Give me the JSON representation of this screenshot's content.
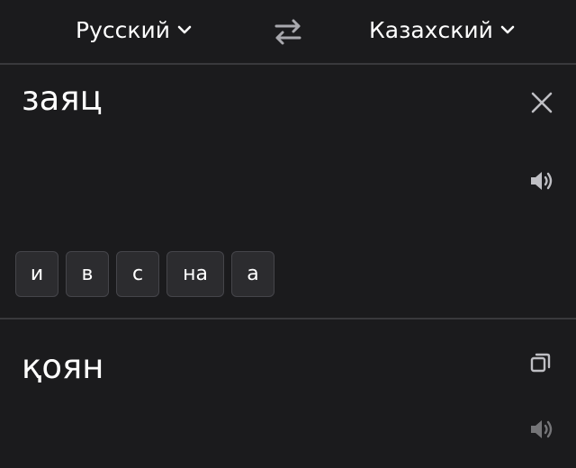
{
  "languages": {
    "source": "Русский",
    "target": "Казахский"
  },
  "input": {
    "text": "заяц"
  },
  "suggestions": [
    "и",
    "в",
    "с",
    "на",
    "а"
  ],
  "output": {
    "text": "қоян"
  },
  "icons": {
    "chevron": "chevron-down-icon",
    "swap": "swap-arrows-icon",
    "clear": "close-icon",
    "speaker": "speaker-icon",
    "copy": "copy-icon"
  },
  "colors": {
    "background": "#1b1b1d",
    "divider": "#39393c",
    "chip_bg": "#2c2c2f",
    "chip_border": "#45454a",
    "icon": "#bfbfc4"
  }
}
